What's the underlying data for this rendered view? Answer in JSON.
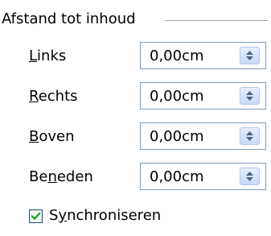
{
  "section": {
    "title": "Afstand tot inhoud"
  },
  "fields": [
    {
      "label_pre": "",
      "label_key": "L",
      "label_post": "inks",
      "value": "0,00cm"
    },
    {
      "label_pre": "",
      "label_key": "R",
      "label_post": "echts",
      "value": "0,00cm"
    },
    {
      "label_pre": "",
      "label_key": "B",
      "label_post": "oven",
      "value": "0,00cm"
    },
    {
      "label_pre": "Be",
      "label_key": "n",
      "label_post": "eden",
      "value": "0,00cm"
    }
  ],
  "sync": {
    "label_pre": "S",
    "label_key": "y",
    "label_post": "nchroniseren",
    "checked": true
  },
  "icons": {
    "spin": "spin-up-down-icon",
    "check": "checkmark-icon"
  },
  "colors": {
    "spin_arrow": "#4d6185",
    "check": "#21a121",
    "field_border": "#7f9db9"
  }
}
